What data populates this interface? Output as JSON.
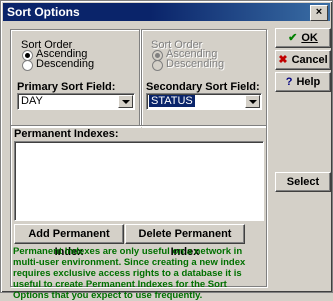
{
  "title": "Sort Options",
  "close_glyph": "×",
  "sort_order": {
    "label": "Sort Order",
    "ascending": "Ascending",
    "descending": "Descending"
  },
  "secondary_sort_order": {
    "label": "Sort Order",
    "ascending": "Ascending",
    "descending": "Descending"
  },
  "primary_sort_field": {
    "label": "Primary Sort Field:",
    "value": "DAY"
  },
  "secondary_sort_field": {
    "label": "Secondary Sort Field:",
    "value": "STATUS"
  },
  "permanent_indexes_label": "Permanent Indexes:",
  "buttons": {
    "ok": "OK",
    "cancel": "Cancel",
    "help": "Help",
    "select": "Select",
    "add_index": "Add Permanent Index",
    "delete_index": "Delete Permanent Index"
  },
  "note": "Permanent Indexes are only useful on a network in multi-user environment. Since creating a new index requires exclusive access rights to a database it is useful to create Permanent Indexes for the Sort Options that you expect to use frequently.",
  "colors": {
    "titlebar": "#0a246a",
    "note": "#007000",
    "ok_icon": "#008000",
    "cancel_icon": "#c00000",
    "help_icon": "#000080"
  }
}
